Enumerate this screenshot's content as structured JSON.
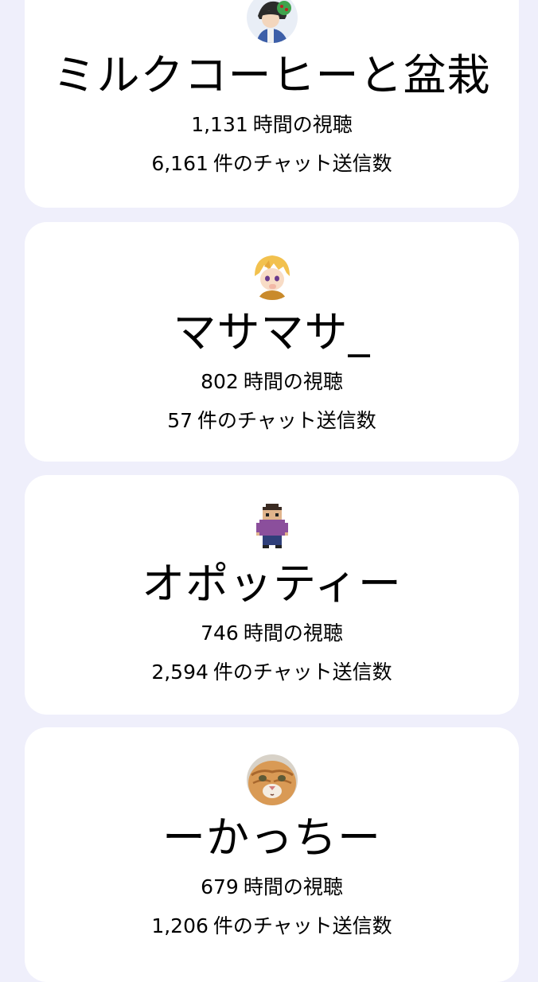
{
  "viewers": [
    {
      "avatar_icon": "anime-character-avatar-icon",
      "name": "ミルクコーヒーと盆栽",
      "hours": "1,131",
      "hours_label": "時間の視聴",
      "chats": "6,161",
      "chats_label": "件のチャット送信数"
    },
    {
      "avatar_icon": "blonde-anime-boy-avatar-icon",
      "name": "マサマサ_",
      "hours": "802",
      "hours_label": "時間の視聴",
      "chats": "57",
      "chats_label": "件のチャット送信数"
    },
    {
      "avatar_icon": "pixel-art-character-avatar-icon",
      "name": "オポッティー",
      "hours": "746",
      "hours_label": "時間の視聴",
      "chats": "2,594",
      "chats_label": "件のチャット送信数"
    },
    {
      "avatar_icon": "cat-photo-avatar-icon",
      "name": "ーかっちー",
      "hours": "679",
      "hours_label": "時間の視聴",
      "chats": "1,206",
      "chats_label": "件のチャット送信数"
    }
  ],
  "colors": {
    "background": "#efeffb",
    "card": "#ffffff",
    "text": "#000000"
  }
}
